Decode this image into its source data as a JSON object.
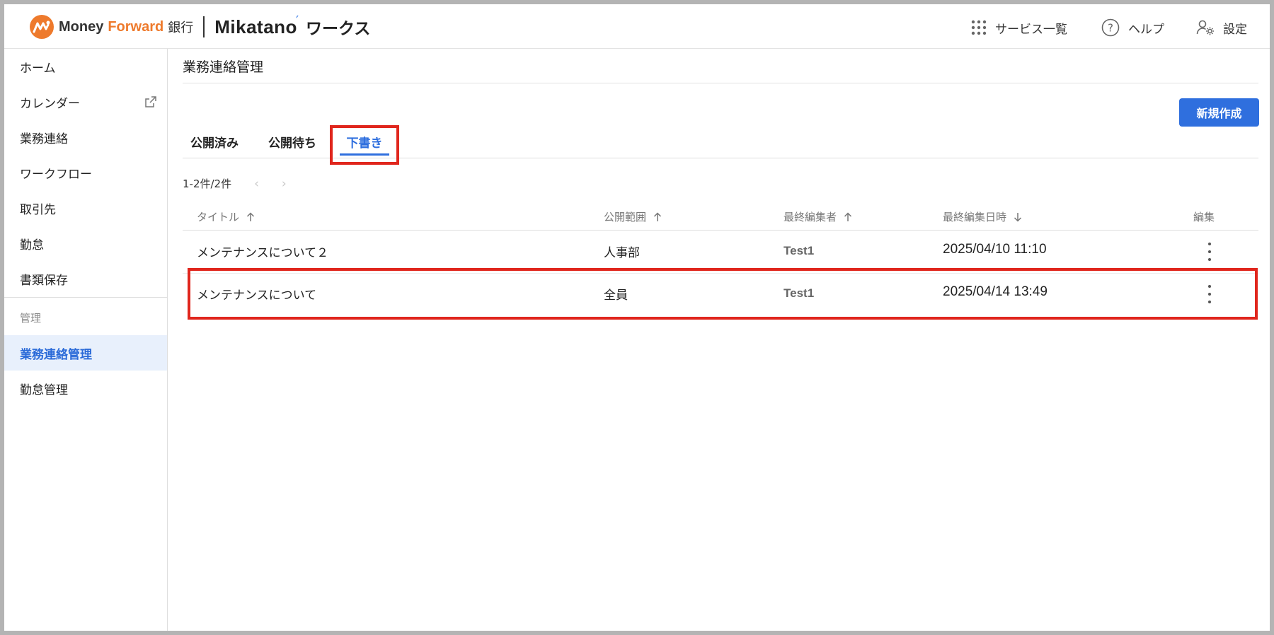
{
  "header": {
    "brand": {
      "money": "Money",
      "forward": "Forward",
      "bank": "銀行",
      "product": "Mikatano",
      "product_suffix": "ワークス"
    },
    "nav": [
      {
        "label": "サービス一覧",
        "icon": "grid-icon"
      },
      {
        "label": "ヘルプ",
        "icon": "help-icon"
      },
      {
        "label": "設定",
        "icon": "user-gear-icon"
      }
    ]
  },
  "sidebar": {
    "items": [
      {
        "label": "ホーム"
      },
      {
        "label": "カレンダー",
        "icon": "external-link-icon"
      },
      {
        "label": "業務連絡"
      },
      {
        "label": "ワークフロー"
      },
      {
        "label": "取引先"
      },
      {
        "label": "勤怠"
      },
      {
        "label": "書類保存"
      }
    ],
    "section_label": "管理",
    "admin_items": [
      {
        "label": "業務連絡管理",
        "active": true
      },
      {
        "label": "勤怠管理"
      }
    ]
  },
  "main": {
    "title": "業務連絡管理",
    "new_button": "新規作成",
    "tabs": [
      {
        "label": "公開済み"
      },
      {
        "label": "公開待ち"
      },
      {
        "label": "下書き",
        "active": true
      }
    ],
    "pager": {
      "text": "1-2件/2件"
    },
    "table": {
      "columns": [
        {
          "label": "タイトル",
          "sort": "up"
        },
        {
          "label": "公開範囲",
          "sort": "up"
        },
        {
          "label": "最終編集者",
          "sort": "up"
        },
        {
          "label": "最終編集日時",
          "sort": "down"
        },
        {
          "label": "編集"
        }
      ],
      "rows": [
        {
          "title": "メンテナンスについて２",
          "scope": "人事部",
          "editor": "Test1",
          "updated": "2025/04/10 11:10"
        },
        {
          "title": "メンテナンスについて",
          "scope": "全員",
          "editor": "Test1",
          "updated": "2025/04/14 13:49"
        }
      ]
    }
  },
  "colors": {
    "accent": "#2f6fde",
    "brand_orange": "#ee7a2c",
    "highlight": "#e0261d",
    "active_bg": "#e8f0fc"
  }
}
